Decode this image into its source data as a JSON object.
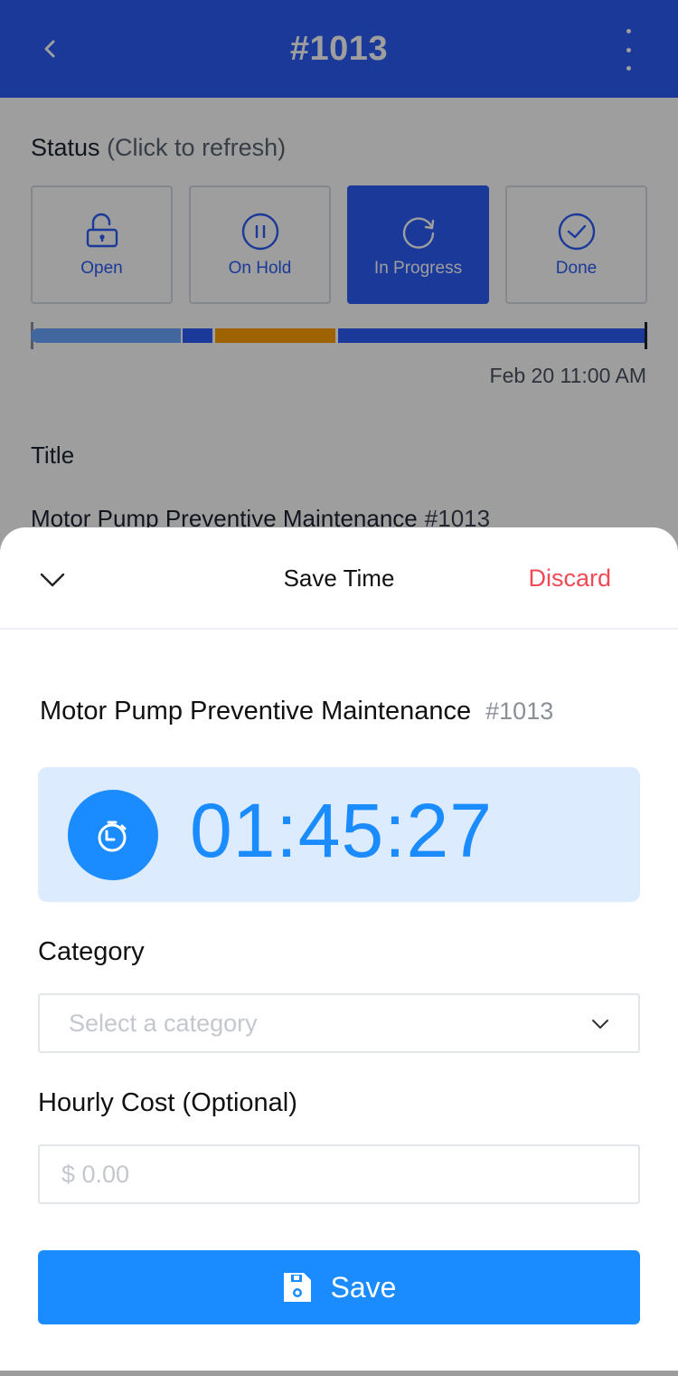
{
  "appbar": {
    "title": "#1013",
    "back_icon": "chevron-left-icon",
    "more_icon": "more-vertical-icon",
    "color": "#2a5cf5"
  },
  "status": {
    "label": "Status",
    "hint": "(Click to refresh)",
    "options": [
      {
        "label": "Open",
        "icon": "unlock-icon",
        "active": false
      },
      {
        "label": "On Hold",
        "icon": "pause-circle-icon",
        "active": false
      },
      {
        "label": "In Progress",
        "icon": "refresh-icon",
        "active": true
      },
      {
        "label": "Done",
        "icon": "check-circle-icon",
        "active": false
      }
    ],
    "timeline": {
      "segments": [
        {
          "status": "Open",
          "start": 0.0,
          "end": 0.245,
          "color": "#6aa6ff"
        },
        {
          "status": "In Progress",
          "start": 0.248,
          "end": 0.296,
          "color": "#2a5cf5"
        },
        {
          "status": "On Hold",
          "start": 0.3,
          "end": 0.497,
          "color": "#ff9f00"
        },
        {
          "status": "In Progress",
          "start": 0.5,
          "end": 1.0,
          "color": "#2a5cf5"
        }
      ],
      "end_date": "Feb 20 11:00 AM"
    }
  },
  "details": {
    "title_label": "Title",
    "title_value": "Motor Pump Preventive Maintenance",
    "title_number": "#1013"
  },
  "sheet": {
    "title": "Save Time",
    "discard_label": "Discard",
    "discard_color": "#ef4a55",
    "collapse_icon": "chevron-down-icon",
    "work_order_title": "Motor Pump Preventive Maintenance",
    "work_order_number": "#1013",
    "timer": {
      "icon": "stopwatch-icon",
      "elapsed": "01:45:27",
      "color": "#1a8cff"
    },
    "category": {
      "label": "Category",
      "placeholder": "Select a category",
      "value": ""
    },
    "hourly_cost": {
      "label": "Hourly Cost (Optional)",
      "placeholder": "$ 0.00",
      "value": ""
    },
    "save_button": {
      "label": "Save",
      "icon": "floppy-disk-icon",
      "color": "#1a8cff"
    }
  }
}
